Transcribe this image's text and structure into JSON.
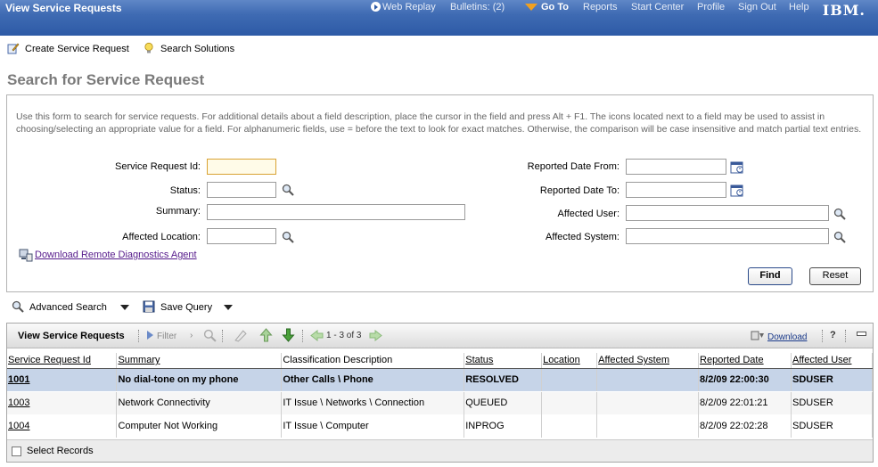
{
  "header": {
    "app_title": "View Service Requests",
    "web_replay": "Web Replay",
    "bulletins": "Bulletins: (2)",
    "go_to": "Go To",
    "reports": "Reports",
    "start_center": "Start Center",
    "profile": "Profile",
    "sign_out": "Sign Out",
    "help": "Help",
    "logo": "IBM."
  },
  "actions": {
    "create": "Create Service Request",
    "search_solutions": "Search Solutions"
  },
  "page_title": "Search for Service Request",
  "form": {
    "help_text": "Use this form to search for service requests. For additional details about a field description, place the cursor in the field and press Alt + F1. The icons located next to a field may be used to assist in choosing/selecting an appropriate value for a field. For alphanumeric fields, use = before the text to look for exact matches. Otherwise, the comparison will be case insensitive and match partial text entries.",
    "labels": {
      "sr_id": "Service Request Id:",
      "status": "Status:",
      "summary": "Summary:",
      "affected_location": "Affected Location:",
      "reported_from": "Reported Date From:",
      "reported_to": "Reported Date To:",
      "affected_user": "Affected User:",
      "affected_system": "Affected System:"
    },
    "download_link": "Download Remote Diagnostics Agent",
    "find": "Find",
    "reset": "Reset"
  },
  "query": {
    "advanced_search": "Advanced Search",
    "save_query": "Save Query"
  },
  "table": {
    "title": "View Service Requests",
    "filter": "Filter",
    "pagination": "1 - 3 of 3",
    "download": "Download",
    "help": "?",
    "columns": [
      "Service Request Id",
      "Summary",
      "Classification Description",
      "Status",
      "Location",
      "Affected System",
      "Reported Date",
      "Affected User"
    ],
    "rows": [
      [
        "1001",
        "No dial-tone on my phone",
        "Other Calls \\ Phone",
        "RESOLVED",
        "",
        "",
        "8/2/09 22:00:30",
        "SDUSER"
      ],
      [
        "1003",
        "Network Connectivity",
        "IT Issue \\ Networks \\ Connection",
        "QUEUED",
        "",
        "",
        "8/2/09 22:01:21",
        "SDUSER"
      ],
      [
        "1004",
        "Computer Not Working",
        "IT Issue \\ Computer",
        "INPROG",
        "",
        "",
        "8/2/09 22:02:28",
        "SDUSER"
      ]
    ],
    "select_records": "Select Records"
  }
}
